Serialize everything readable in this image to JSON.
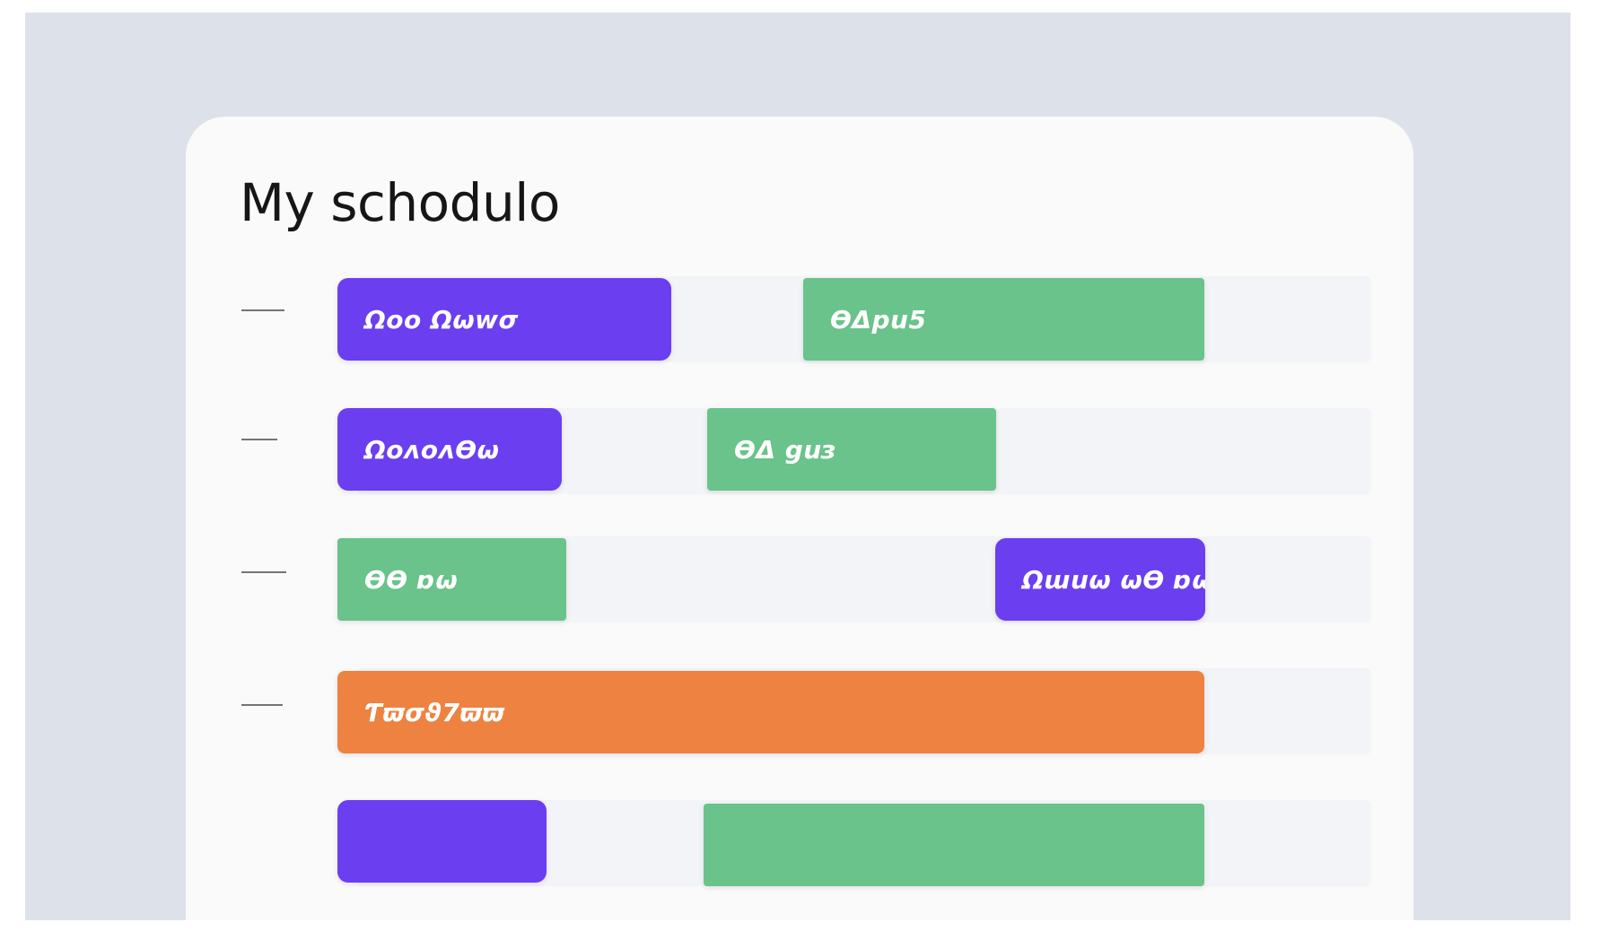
{
  "schedule": {
    "title": "My schodulo",
    "rows": [
      {
        "label": "",
        "events": [
          {
            "text": "Ωoo Ωωwσ",
            "color": "purple"
          },
          {
            "text": "ϴΔpu5",
            "color": "green"
          }
        ]
      },
      {
        "label": "",
        "events": [
          {
            "text": "Ωoᴧoᴧϴω",
            "color": "purple"
          },
          {
            "text": "ϴΔ guɜ",
            "color": "green"
          }
        ]
      },
      {
        "label": "",
        "events": [
          {
            "text": "ϴϴ ɒω",
            "color": "green"
          },
          {
            "text": "Ωɯuω ωϴ ɒω",
            "color": "purple"
          }
        ]
      },
      {
        "label": "",
        "events": [
          {
            "text": "Ƭϖσϑ7ϖϖ",
            "color": "orange"
          }
        ]
      },
      {
        "label": "",
        "events": [
          {
            "text": "",
            "color": "purple"
          },
          {
            "text": "",
            "color": "green"
          }
        ]
      }
    ]
  },
  "colors": {
    "purple": "#6b3ef0",
    "green": "#69c38a",
    "orange": "#ee8240",
    "background": "#dde1ea",
    "card": "#fafafa"
  }
}
